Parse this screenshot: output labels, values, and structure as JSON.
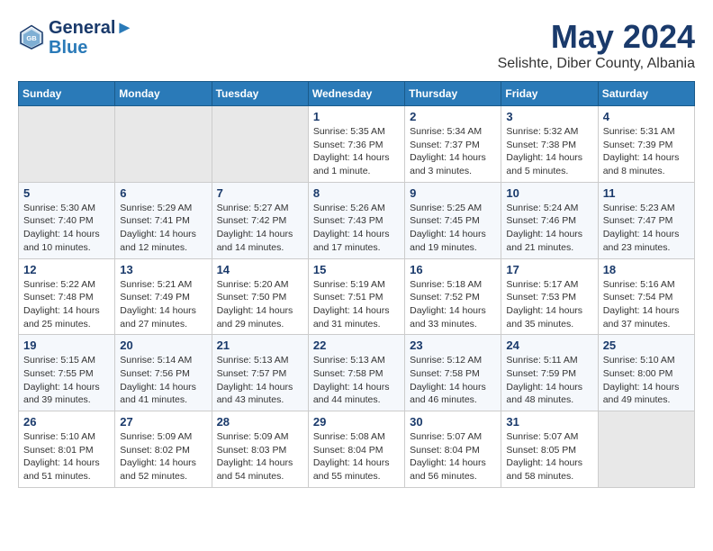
{
  "logo": {
    "line1": "General",
    "line2": "Blue"
  },
  "title": "May 2024",
  "location": "Selishte, Diber County, Albania",
  "days_of_week": [
    "Sunday",
    "Monday",
    "Tuesday",
    "Wednesday",
    "Thursday",
    "Friday",
    "Saturday"
  ],
  "weeks": [
    [
      {
        "day": "",
        "info": ""
      },
      {
        "day": "",
        "info": ""
      },
      {
        "day": "",
        "info": ""
      },
      {
        "day": "1",
        "info": "Sunrise: 5:35 AM\nSunset: 7:36 PM\nDaylight: 14 hours\nand 1 minute."
      },
      {
        "day": "2",
        "info": "Sunrise: 5:34 AM\nSunset: 7:37 PM\nDaylight: 14 hours\nand 3 minutes."
      },
      {
        "day": "3",
        "info": "Sunrise: 5:32 AM\nSunset: 7:38 PM\nDaylight: 14 hours\nand 5 minutes."
      },
      {
        "day": "4",
        "info": "Sunrise: 5:31 AM\nSunset: 7:39 PM\nDaylight: 14 hours\nand 8 minutes."
      }
    ],
    [
      {
        "day": "5",
        "info": "Sunrise: 5:30 AM\nSunset: 7:40 PM\nDaylight: 14 hours\nand 10 minutes."
      },
      {
        "day": "6",
        "info": "Sunrise: 5:29 AM\nSunset: 7:41 PM\nDaylight: 14 hours\nand 12 minutes."
      },
      {
        "day": "7",
        "info": "Sunrise: 5:27 AM\nSunset: 7:42 PM\nDaylight: 14 hours\nand 14 minutes."
      },
      {
        "day": "8",
        "info": "Sunrise: 5:26 AM\nSunset: 7:43 PM\nDaylight: 14 hours\nand 17 minutes."
      },
      {
        "day": "9",
        "info": "Sunrise: 5:25 AM\nSunset: 7:45 PM\nDaylight: 14 hours\nand 19 minutes."
      },
      {
        "day": "10",
        "info": "Sunrise: 5:24 AM\nSunset: 7:46 PM\nDaylight: 14 hours\nand 21 minutes."
      },
      {
        "day": "11",
        "info": "Sunrise: 5:23 AM\nSunset: 7:47 PM\nDaylight: 14 hours\nand 23 minutes."
      }
    ],
    [
      {
        "day": "12",
        "info": "Sunrise: 5:22 AM\nSunset: 7:48 PM\nDaylight: 14 hours\nand 25 minutes."
      },
      {
        "day": "13",
        "info": "Sunrise: 5:21 AM\nSunset: 7:49 PM\nDaylight: 14 hours\nand 27 minutes."
      },
      {
        "day": "14",
        "info": "Sunrise: 5:20 AM\nSunset: 7:50 PM\nDaylight: 14 hours\nand 29 minutes."
      },
      {
        "day": "15",
        "info": "Sunrise: 5:19 AM\nSunset: 7:51 PM\nDaylight: 14 hours\nand 31 minutes."
      },
      {
        "day": "16",
        "info": "Sunrise: 5:18 AM\nSunset: 7:52 PM\nDaylight: 14 hours\nand 33 minutes."
      },
      {
        "day": "17",
        "info": "Sunrise: 5:17 AM\nSunset: 7:53 PM\nDaylight: 14 hours\nand 35 minutes."
      },
      {
        "day": "18",
        "info": "Sunrise: 5:16 AM\nSunset: 7:54 PM\nDaylight: 14 hours\nand 37 minutes."
      }
    ],
    [
      {
        "day": "19",
        "info": "Sunrise: 5:15 AM\nSunset: 7:55 PM\nDaylight: 14 hours\nand 39 minutes."
      },
      {
        "day": "20",
        "info": "Sunrise: 5:14 AM\nSunset: 7:56 PM\nDaylight: 14 hours\nand 41 minutes."
      },
      {
        "day": "21",
        "info": "Sunrise: 5:13 AM\nSunset: 7:57 PM\nDaylight: 14 hours\nand 43 minutes."
      },
      {
        "day": "22",
        "info": "Sunrise: 5:13 AM\nSunset: 7:58 PM\nDaylight: 14 hours\nand 44 minutes."
      },
      {
        "day": "23",
        "info": "Sunrise: 5:12 AM\nSunset: 7:58 PM\nDaylight: 14 hours\nand 46 minutes."
      },
      {
        "day": "24",
        "info": "Sunrise: 5:11 AM\nSunset: 7:59 PM\nDaylight: 14 hours\nand 48 minutes."
      },
      {
        "day": "25",
        "info": "Sunrise: 5:10 AM\nSunset: 8:00 PM\nDaylight: 14 hours\nand 49 minutes."
      }
    ],
    [
      {
        "day": "26",
        "info": "Sunrise: 5:10 AM\nSunset: 8:01 PM\nDaylight: 14 hours\nand 51 minutes."
      },
      {
        "day": "27",
        "info": "Sunrise: 5:09 AM\nSunset: 8:02 PM\nDaylight: 14 hours\nand 52 minutes."
      },
      {
        "day": "28",
        "info": "Sunrise: 5:09 AM\nSunset: 8:03 PM\nDaylight: 14 hours\nand 54 minutes."
      },
      {
        "day": "29",
        "info": "Sunrise: 5:08 AM\nSunset: 8:04 PM\nDaylight: 14 hours\nand 55 minutes."
      },
      {
        "day": "30",
        "info": "Sunrise: 5:07 AM\nSunset: 8:04 PM\nDaylight: 14 hours\nand 56 minutes."
      },
      {
        "day": "31",
        "info": "Sunrise: 5:07 AM\nSunset: 8:05 PM\nDaylight: 14 hours\nand 58 minutes."
      },
      {
        "day": "",
        "info": ""
      }
    ]
  ]
}
